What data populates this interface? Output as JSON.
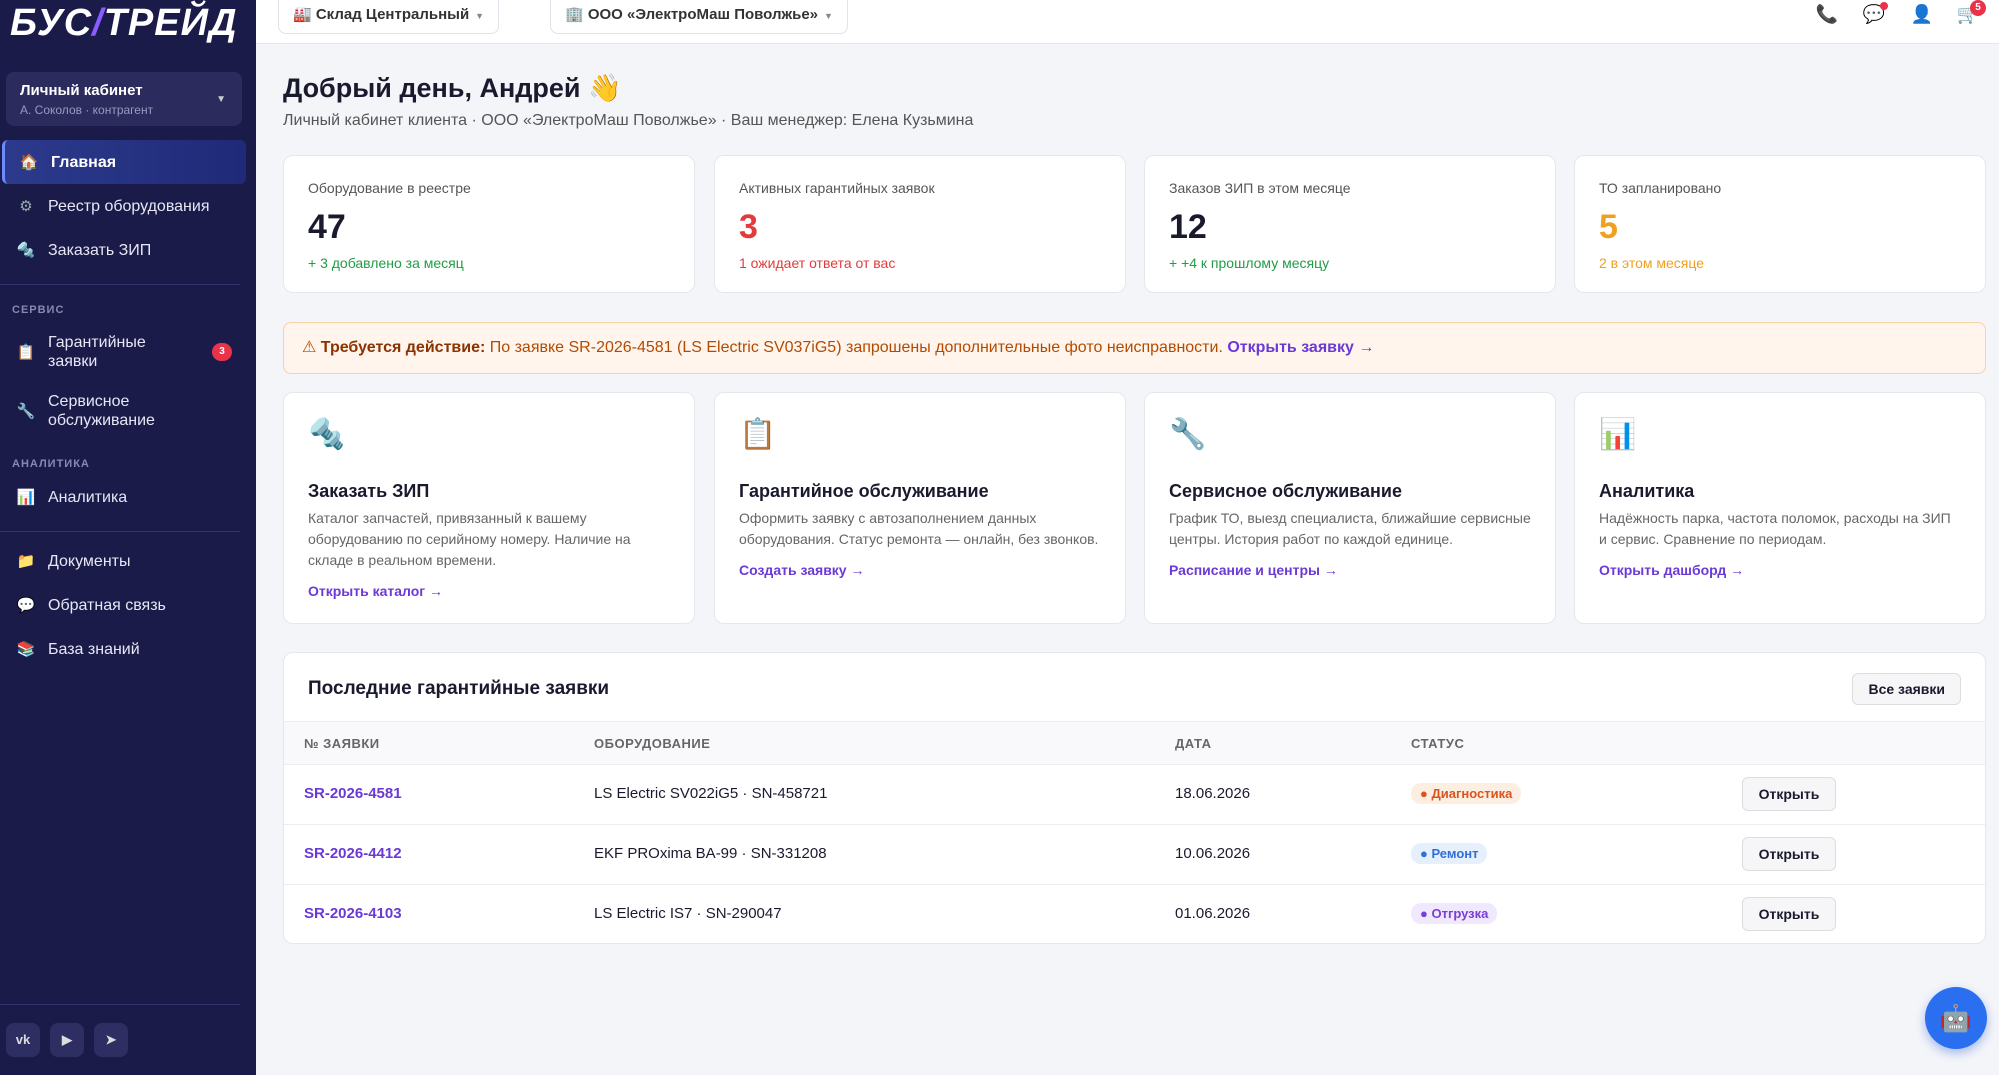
{
  "brand": {
    "logo_a": "БУС",
    "logo_b": "ТРЕЙД"
  },
  "account": {
    "title": "Личный кабинет",
    "subtitle": "А. Соколов · контрагент"
  },
  "nav": {
    "main": [
      {
        "label": "Главная",
        "icon": "home-icon"
      },
      {
        "label": "Реестр оборудования",
        "icon": "gear-icon"
      },
      {
        "label": "Заказать ЗИП",
        "icon": "wrench-icon"
      }
    ],
    "service_title": "СЕРВИС",
    "service": [
      {
        "label": "Гарантийные заявки",
        "icon": "clipboard-icon",
        "badge": "3"
      },
      {
        "label": "Сервисное обслуживание",
        "icon": "tool-icon"
      }
    ],
    "analytics_title": "АНАЛИТИКА",
    "analytics": [
      {
        "label": "Аналитика",
        "icon": "chart-icon"
      }
    ],
    "other": [
      {
        "label": "Документы",
        "icon": "folder-icon"
      },
      {
        "label": "Обратная связь",
        "icon": "chat-icon"
      },
      {
        "label": "База знаний",
        "icon": "books-icon"
      }
    ]
  },
  "social": [
    "vk",
    "▶",
    "➤"
  ],
  "topbar": {
    "warehouse": "🏭 Склад Центральный",
    "company": "🏢 ООО «ЭлектроМаш Поволжье»",
    "cart_count": "5"
  },
  "greeting": {
    "title": "Добрый день, Андрей 👋",
    "subtitle": "Личный кабинет клиента · ООО «ЭлектроМаш Поволжье» · Ваш менеджер: Елена Кузьмина"
  },
  "stats": [
    {
      "label": "Оборудование в реестре",
      "value": "47",
      "note": "+ 3 добавлено за месяц",
      "color": "#1a1a2e",
      "note_color": "#1f9d45"
    },
    {
      "label": "Активных гарантийных заявок",
      "value": "3",
      "note": "1 ожидает ответа от вас",
      "color": "#e33b3b",
      "note_color": "#e33b3b"
    },
    {
      "label": "Заказов ЗИП в этом месяце",
      "value": "12",
      "note": "+ +4 к прошлому месяцу",
      "color": "#1a1a2e",
      "note_color": "#1f9d45"
    },
    {
      "label": "ТО запланировано",
      "value": "5",
      "note": "2 в этом месяце",
      "color": "#f0a020",
      "note_color": "#f0a020"
    }
  ],
  "alert": {
    "icon": "⚠",
    "strong": "Требуется действие:",
    "text": " По заявке SR-2026-4581 (LS Electric SV037iG5) запрошены дополнительные фото неисправности. ",
    "link": "Открыть заявку →"
  },
  "cards": [
    {
      "icon": "🔩",
      "title": "Заказать ЗИП",
      "desc": "Каталог запчастей, привязанный к вашему оборудованию по серийному номеру. Наличие на складе в реальном времени.",
      "link": "Открыть каталог →"
    },
    {
      "icon": "📋",
      "title": "Гарантийное обслуживание",
      "desc": "Оформить заявку с автозаполнением данных оборудования. Статус ремонта — онлайн, без звонков.",
      "link": "Создать заявку →"
    },
    {
      "icon": "🔧",
      "title": "Сервисное обслуживание",
      "desc": "График ТО, выезд специалиста, ближайшие сервисные центры. История работ по каждой единице.",
      "link": "Расписание и центры →"
    },
    {
      "icon": "📊",
      "title": "Аналитика",
      "desc": "Надёжность парка, частота поломок, расходы на ЗИП и сервис. Сравнение по периодам.",
      "link": "Открыть дашборд →"
    }
  ],
  "table": {
    "title": "Последние гарантийные заявки",
    "all_button": "Все заявки",
    "headers": [
      "№ ЗАЯВКИ",
      "ОБОРУДОВАНИЕ",
      "ДАТА",
      "СТАТУС"
    ],
    "rows": [
      {
        "id": "SR-2026-4581",
        "equipment": "LS Electric SV022iG5 · SN-458721",
        "date": "18.06.2026",
        "status": "● Диагностика",
        "status_color": "#d9541e",
        "status_bg": "#fdeee2",
        "action": "Открыть"
      },
      {
        "id": "SR-2026-4412",
        "equipment": "EKF PROxima BA-99 · SN-331208",
        "date": "10.06.2026",
        "status": "● Ремонт",
        "status_color": "#2f6fd6",
        "status_bg": "#e6effc",
        "action": "Открыть"
      },
      {
        "id": "SR-2026-4103",
        "equipment": "LS Electric IS7 · SN-290047",
        "date": "01.06.2026",
        "status": "● Отгрузка",
        "status_color": "#7a3fd6",
        "status_bg": "#f0e8fc",
        "action": "Открыть"
      }
    ]
  },
  "assistant": {
    "icon": "🤖"
  }
}
